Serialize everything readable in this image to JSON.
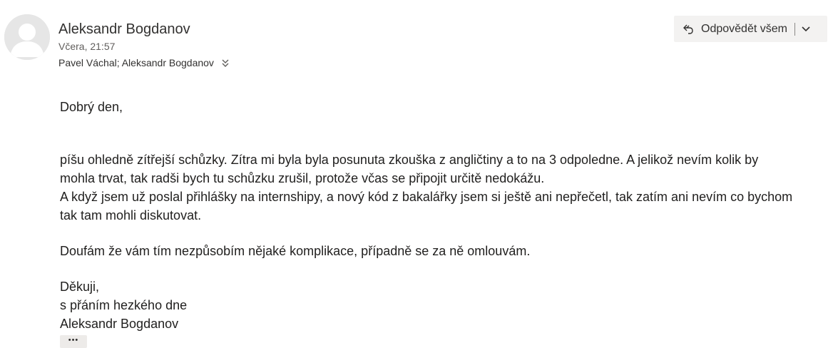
{
  "header": {
    "sender_name": "Aleksandr Bogdanov",
    "sent_time": "Včera, 21:57",
    "recipients": "Pavel Váchal; Aleksandr Bogdanov"
  },
  "actions": {
    "reply_all_label": "Odpovědět všem"
  },
  "body": {
    "greeting": "Dobrý den,",
    "line1": "píšu ohledně zítřejší schůzky. Zítra mi byla byla posunuta zkouška z angličtiny a to na 3 odpoledne. A jelikož nevím kolik by",
    "line2": "mohla trvat, tak radši bych tu schůzku zrušil, protože včas se připojit určitě nedokážu.",
    "line3": "A když jsem už poslal přihlášky na internshipy, a nový kód z bakalářky jsem si ještě ani nepřečetl, tak zatím ani nevím co bychom",
    "line4": "tak tam mohli diskutovat.",
    "apology": "Doufám že vám tím nezpůsobím nějaké komplikace, případně se za ně omlouvám.",
    "sign1": "Děkuji,",
    "sign2": "s přáním hezkého dne",
    "sign3": "Aleksandr Bogdanov"
  },
  "more_button_label": "•••",
  "icons": {
    "avatar": "person-avatar-icon",
    "expand": "double-chevron-down-icon",
    "reply_all": "reply-all-icon",
    "dropdown": "chevron-down-icon"
  }
}
